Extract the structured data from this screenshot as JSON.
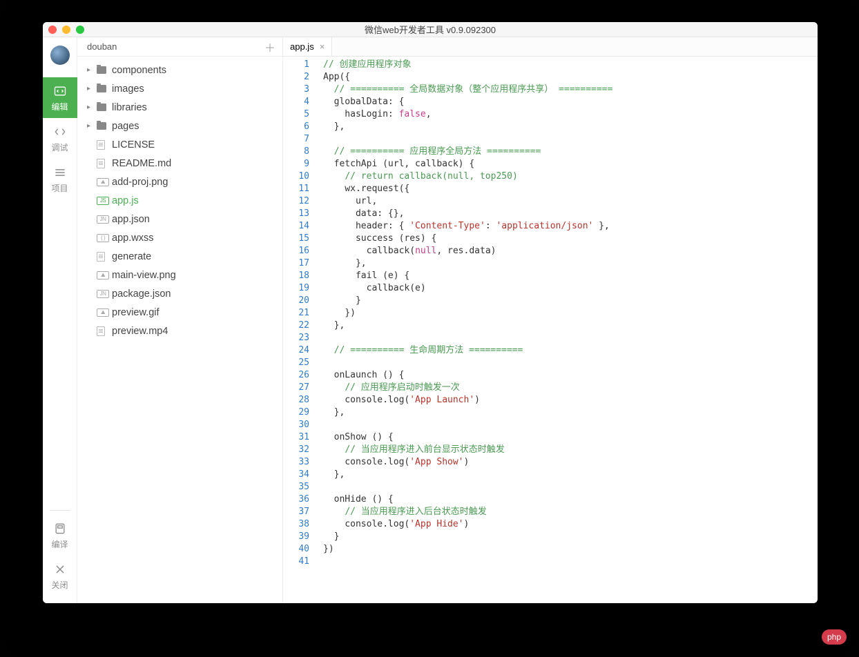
{
  "window_title": "微信web开发者工具 v0.9.092300",
  "project_name": "douban",
  "nav": {
    "edit": "编辑",
    "debug": "调试",
    "project": "项目",
    "compile": "编译",
    "close": "关闭"
  },
  "tree": {
    "folders": [
      {
        "name": "components"
      },
      {
        "name": "images"
      },
      {
        "name": "libraries"
      },
      {
        "name": "pages"
      }
    ],
    "files": [
      {
        "name": "LICENSE",
        "icon": "doc"
      },
      {
        "name": "README.md",
        "icon": "doc"
      },
      {
        "name": "add-proj.png",
        "icon": "img"
      },
      {
        "name": "app.js",
        "icon": "js",
        "active": true
      },
      {
        "name": "app.json",
        "icon": "jn"
      },
      {
        "name": "app.wxss",
        "icon": "brace"
      },
      {
        "name": "generate",
        "icon": "doc"
      },
      {
        "name": "main-view.png",
        "icon": "img"
      },
      {
        "name": "package.json",
        "icon": "jn"
      },
      {
        "name": "preview.gif",
        "icon": "img"
      },
      {
        "name": "preview.mp4",
        "icon": "doc"
      }
    ]
  },
  "tabs": [
    {
      "label": "app.js",
      "active": true
    }
  ],
  "code": {
    "lines": [
      [
        [
          "c",
          "// 创建应用程序对象"
        ]
      ],
      [
        [
          "",
          "App({"
        ]
      ],
      [
        [
          "",
          "  "
        ],
        [
          "c",
          "// ========== 全局数据对象（整个应用程序共享） =========="
        ]
      ],
      [
        [
          "",
          "  globalData: {"
        ]
      ],
      [
        [
          "",
          "    hasLogin: "
        ],
        [
          "k",
          "false"
        ],
        [
          "",
          ","
        ]
      ],
      [
        [
          "",
          "  },"
        ]
      ],
      [
        [
          "",
          ""
        ]
      ],
      [
        [
          "",
          "  "
        ],
        [
          "c",
          "// ========== 应用程序全局方法 =========="
        ]
      ],
      [
        [
          "",
          "  fetchApi (url, callback) {"
        ]
      ],
      [
        [
          "",
          "    "
        ],
        [
          "c",
          "// return callback(null, top250)"
        ]
      ],
      [
        [
          "",
          "    wx.request({"
        ]
      ],
      [
        [
          "",
          "      url,"
        ]
      ],
      [
        [
          "",
          "      data: {},"
        ]
      ],
      [
        [
          "",
          "      header: { "
        ],
        [
          "s",
          "'Content-Type'"
        ],
        [
          "",
          ": "
        ],
        [
          "s",
          "'application/json'"
        ],
        [
          "",
          " },"
        ]
      ],
      [
        [
          "",
          "      success (res) {"
        ]
      ],
      [
        [
          "",
          "        callback("
        ],
        [
          "k",
          "null"
        ],
        [
          "",
          ", res.data)"
        ]
      ],
      [
        [
          "",
          "      },"
        ]
      ],
      [
        [
          "",
          "      fail (e) {"
        ]
      ],
      [
        [
          "",
          "        callback(e)"
        ]
      ],
      [
        [
          "",
          "      }"
        ]
      ],
      [
        [
          "",
          "    })"
        ]
      ],
      [
        [
          "",
          "  },"
        ]
      ],
      [
        [
          "",
          ""
        ]
      ],
      [
        [
          "",
          "  "
        ],
        [
          "c",
          "// ========== 生命周期方法 =========="
        ]
      ],
      [
        [
          "",
          ""
        ]
      ],
      [
        [
          "",
          "  onLaunch () {"
        ]
      ],
      [
        [
          "",
          "    "
        ],
        [
          "c",
          "// 应用程序启动时触发一次"
        ]
      ],
      [
        [
          "",
          "    console.log("
        ],
        [
          "s",
          "'App Launch'"
        ],
        [
          "",
          ")"
        ]
      ],
      [
        [
          "",
          "  },"
        ]
      ],
      [
        [
          "",
          ""
        ]
      ],
      [
        [
          "",
          "  onShow () {"
        ]
      ],
      [
        [
          "",
          "    "
        ],
        [
          "c",
          "// 当应用程序进入前台显示状态时触发"
        ]
      ],
      [
        [
          "",
          "    console.log("
        ],
        [
          "s",
          "'App Show'"
        ],
        [
          "",
          ")"
        ]
      ],
      [
        [
          "",
          "  },"
        ]
      ],
      [
        [
          "",
          ""
        ]
      ],
      [
        [
          "",
          "  onHide () {"
        ]
      ],
      [
        [
          "",
          "    "
        ],
        [
          "c",
          "// 当应用程序进入后台状态时触发"
        ]
      ],
      [
        [
          "",
          "    console.log("
        ],
        [
          "s",
          "'App Hide'"
        ],
        [
          "",
          ")"
        ]
      ],
      [
        [
          "",
          "  }"
        ]
      ],
      [
        [
          "",
          "})"
        ]
      ],
      [
        [
          "",
          ""
        ]
      ]
    ]
  },
  "watermark": "php"
}
